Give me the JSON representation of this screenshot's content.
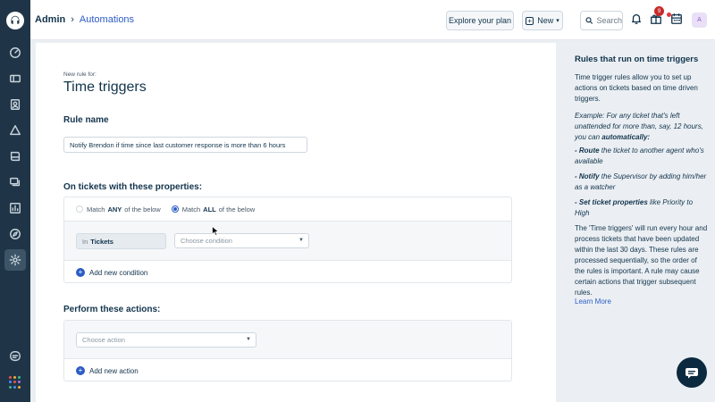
{
  "header": {
    "breadcrumb_root": "Admin",
    "breadcrumb_current": "Automations",
    "plan_button": "Explore your plan",
    "new_button": "New",
    "search_placeholder": "Search",
    "gift_badge": "9",
    "avatar_initial": "A"
  },
  "main": {
    "subtitle": "New rule for:",
    "title": "Time triggers",
    "rule_name_label": "Rule name",
    "rule_name_value": "Notify Brendon if time since last customer response is more than 6 hours",
    "conditions_label": "On tickets with these properties:",
    "match_any": {
      "pre": "Match",
      "strong": "ANY",
      "post": "of the below",
      "selected": false
    },
    "match_all": {
      "pre": "Match",
      "strong": "ALL",
      "post": "of the below",
      "selected": true
    },
    "in_label": "In",
    "in_value": "Tickets",
    "condition_placeholder": "Choose condition",
    "add_condition": "Add new condition",
    "actions_label": "Perform these actions:",
    "action_placeholder": "Choose action",
    "add_action": "Add new action"
  },
  "aside": {
    "title": "Rules that run on time triggers",
    "intro": "Time trigger rules allow you to set up actions on tickets based on time driven triggers.",
    "example_pre": "Example: For any ticket that's left unattended for more than, say, 12 hours, you can",
    "example_strong": "automatically:",
    "route_strong": "- Route",
    "route_rest": "the ticket to another agent who's available",
    "notify_strong": "- Notify",
    "notify_rest": "the Supervisor by adding him/her as a watcher",
    "set_strong": "- Set ticket properties",
    "set_rest": "like Priority to High",
    "body": "The 'Time triggers' will run every hour and process tickets that have been updated within the last 30 days. These rules are processed sequentially, so the order of the rules is important. A rule may cause certain actions that trigger subsequent rules.",
    "learn_more": "Learn More"
  },
  "colors": {
    "sidebar": "#1f3547",
    "accent": "#2c5cc5",
    "badge": "#c92a2a",
    "chat": "#0b2a3f"
  },
  "icons": {
    "sidebar": [
      "logo-headset-icon",
      "dashboard-icon",
      "tickets-icon",
      "contacts-icon",
      "groups-icon",
      "book-icon",
      "chat-bubbles-icon",
      "reports-icon",
      "compass-icon",
      "gear-icon",
      "feedback-icon",
      "apps-grid-icon"
    ],
    "header": [
      "search-icon",
      "bell-icon",
      "gift-icon",
      "calendar-icon"
    ]
  }
}
